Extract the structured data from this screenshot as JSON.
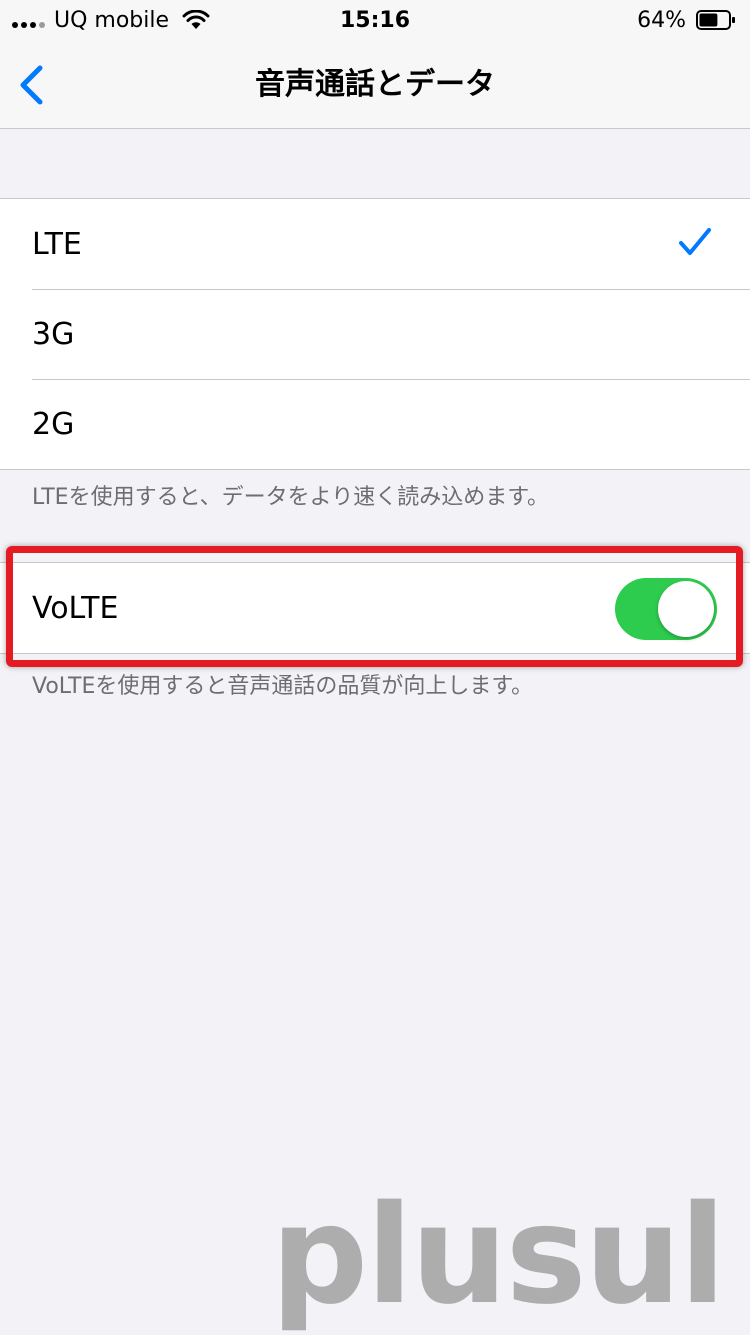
{
  "status_bar": {
    "carrier": "UQ mobile",
    "time": "15:16",
    "battery_percent": "64%",
    "battery_level": 0.64,
    "signal_bars_active": 3,
    "signal_bars_total": 4
  },
  "nav": {
    "back_icon": "chevron-left-icon",
    "title": "音声通話とデータ"
  },
  "network": {
    "options": [
      {
        "label": "LTE",
        "selected": true
      },
      {
        "label": "3G",
        "selected": false
      },
      {
        "label": "2G",
        "selected": false
      }
    ],
    "footer": "LTEを使用すると、データをより速く読み込めます。"
  },
  "volte": {
    "label": "VoLTE",
    "enabled": true,
    "footer": "VoLTEを使用すると音声通話の品質が向上します。"
  },
  "watermark": "plusul",
  "colors": {
    "accent": "#007aff",
    "toggle_on": "#2ecc4e",
    "highlight": "#e41b23",
    "background": "#f2f2f7"
  }
}
